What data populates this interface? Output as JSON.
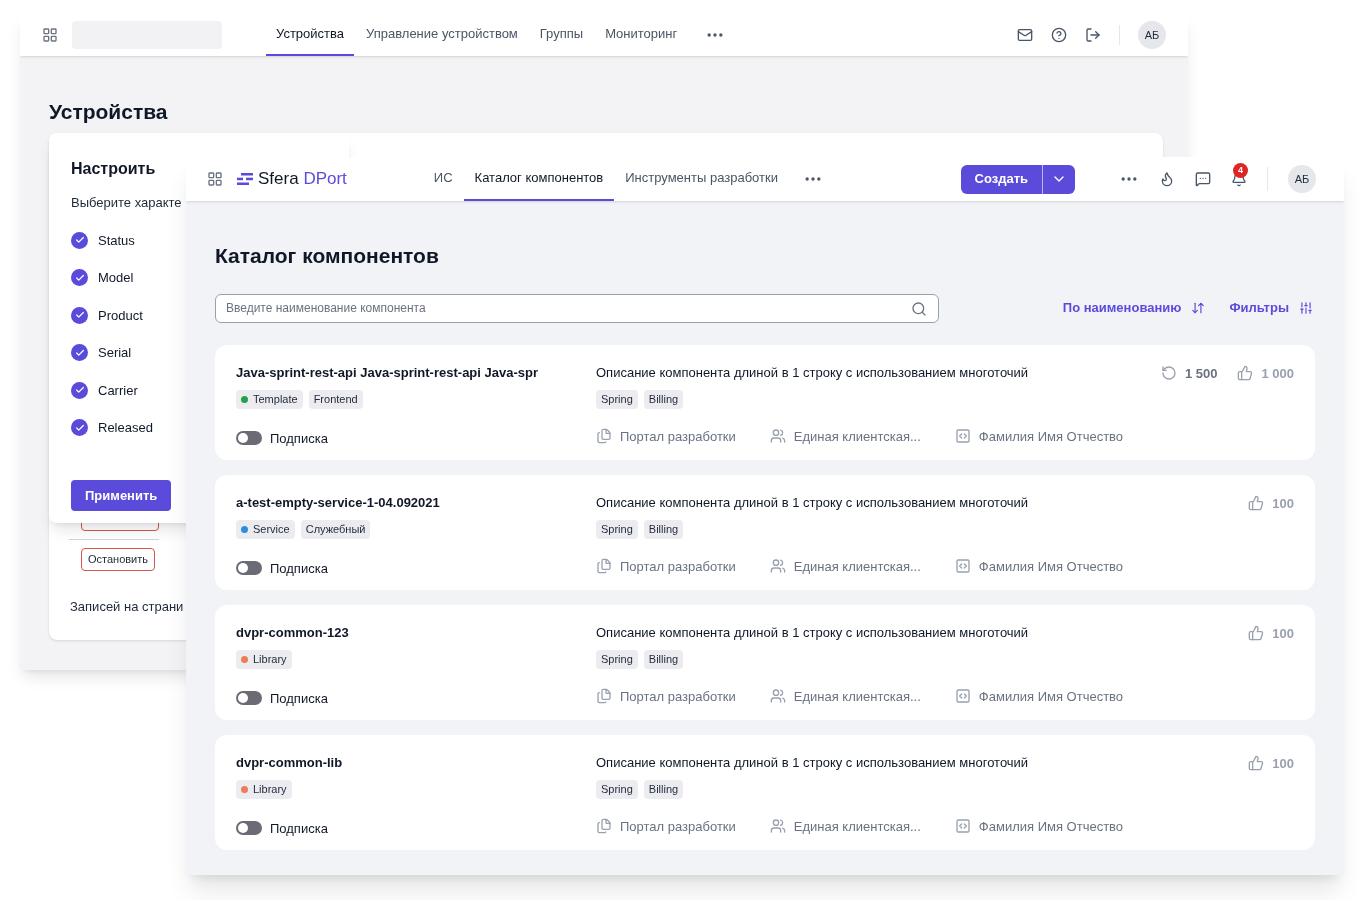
{
  "back_window": {
    "tabs": [
      {
        "label": "Устройства",
        "selected": true
      },
      {
        "label": "Управление устройством",
        "selected": false
      },
      {
        "label": "Группы",
        "selected": false
      },
      {
        "label": "Мониторинг",
        "selected": false
      }
    ],
    "avatar": "АБ",
    "page_title": "Устройства",
    "settings_popover": {
      "title": "Настроить",
      "subtitle": "Выберите характе",
      "options": [
        {
          "label": "Status",
          "checked": true
        },
        {
          "label": "Model",
          "checked": true
        },
        {
          "label": "Product",
          "checked": true
        },
        {
          "label": "Serial",
          "checked": true
        },
        {
          "label": "Carrier",
          "checked": true
        },
        {
          "label": "Released",
          "checked": true
        }
      ],
      "apply_button": "Применить"
    },
    "stop_buttons": [
      "Остановить"
    ],
    "records_label": "Записей на страни"
  },
  "front_window": {
    "logo": {
      "first": "Sfera",
      "second": "DPort"
    },
    "tabs": [
      {
        "label": "ИС",
        "selected": false
      },
      {
        "label": "Каталог компонентов",
        "selected": true
      },
      {
        "label": "Инструменты разработки",
        "selected": false
      }
    ],
    "create_button": "Создать",
    "notification_count": "4",
    "avatar": "АБ",
    "page_title": "Каталог компонентов",
    "search": {
      "placeholder": "Введите наименование компонента"
    },
    "sort_label": "По наименованию",
    "filters_label": "Фильтры",
    "components": [
      {
        "name": "Java-sprint-rest-api Java-sprint-rest-api Java-spr",
        "tags": [
          {
            "label": "Template",
            "color": "#22a04b"
          },
          {
            "label": "Frontend"
          }
        ],
        "subscription": "Подписка",
        "subscribed": false,
        "description": "Описание компонента длиной в 1 строку с использованием многоточий",
        "tech_tags": [
          "Spring",
          "Billing"
        ],
        "links": [
          {
            "kind": "portal",
            "text": "Портал разработки"
          },
          {
            "kind": "team",
            "text": "Единая клиентская..."
          },
          {
            "kind": "owner",
            "text": "Фамилия Имя Отчество"
          }
        ],
        "stats": [
          {
            "kind": "runs",
            "value": "1 500"
          },
          {
            "kind": "likes",
            "value": "1 000"
          }
        ]
      },
      {
        "name": "a-test-empty-service-1-04.092021",
        "tags": [
          {
            "label": "Service",
            "color": "#2d8ee0"
          },
          {
            "label": "Служебный"
          }
        ],
        "subscription": "Подписка",
        "subscribed": false,
        "description": "Описание компонента длиной в 1 строку с использованием многоточий",
        "tech_tags": [
          "Spring",
          "Billing"
        ],
        "links": [
          {
            "kind": "portal",
            "text": "Портал разработки"
          },
          {
            "kind": "team",
            "text": "Единая клиентская..."
          },
          {
            "kind": "owner",
            "text": "Фамилия Имя Отчество"
          }
        ],
        "stats": [
          {
            "kind": "likes",
            "value": "100"
          }
        ]
      },
      {
        "name": "dvpr-common-123",
        "tags": [
          {
            "label": "Library",
            "color": "#f07a5a"
          }
        ],
        "subscription": "Подписка",
        "subscribed": false,
        "description": "Описание компонента длиной в 1 строку с использованием многоточий",
        "tech_tags": [
          "Spring",
          "Billing"
        ],
        "links": [
          {
            "kind": "portal",
            "text": "Портал разработки"
          },
          {
            "kind": "team",
            "text": "Единая клиентская..."
          },
          {
            "kind": "owner",
            "text": "Фамилия Имя Отчество"
          }
        ],
        "stats": [
          {
            "kind": "likes",
            "value": "100"
          }
        ]
      },
      {
        "name": "dvpr-common-lib",
        "tags": [
          {
            "label": "Library",
            "color": "#f07a5a"
          }
        ],
        "subscription": "Подписка",
        "subscribed": false,
        "description": "Описание компонента длиной в 1 строку с использованием многоточий",
        "tech_tags": [
          "Spring",
          "Billing"
        ],
        "links": [
          {
            "kind": "portal",
            "text": "Портал разработки"
          },
          {
            "kind": "team",
            "text": "Единая клиентская..."
          },
          {
            "kind": "owner",
            "text": "Фамилия Имя Отчество"
          }
        ],
        "stats": [
          {
            "kind": "likes",
            "value": "100"
          }
        ]
      }
    ]
  }
}
